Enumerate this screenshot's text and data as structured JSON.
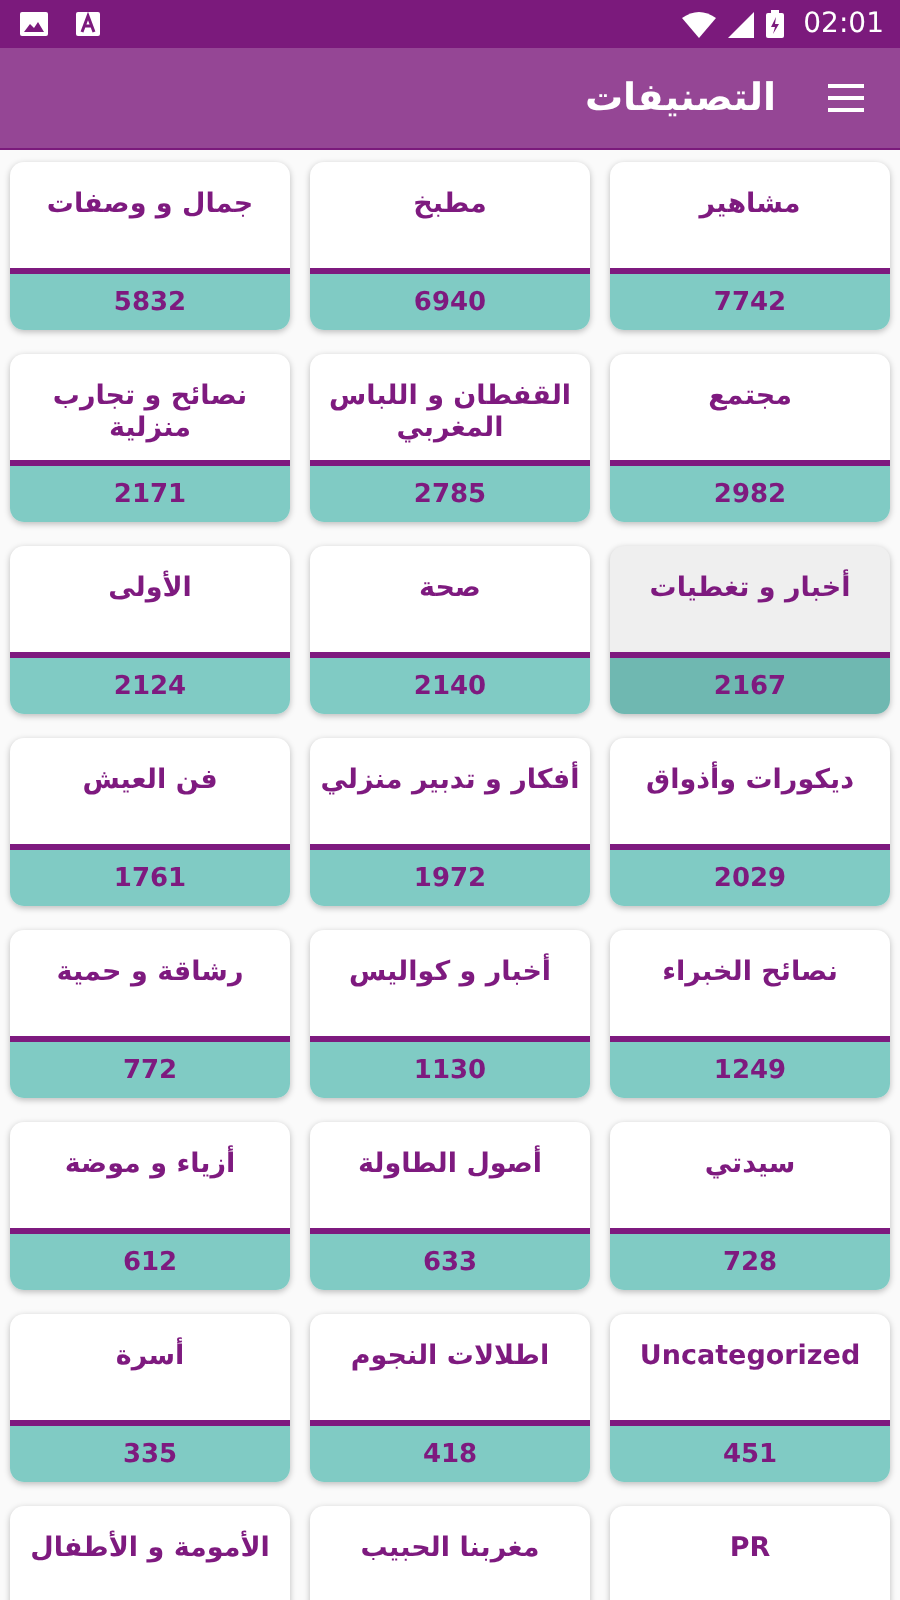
{
  "status_bar": {
    "time": "02:01"
  },
  "toolbar": {
    "title": "التصنيفات"
  },
  "categories": [
    {
      "name": "مشاهير",
      "count": "7742",
      "selected": false
    },
    {
      "name": "مطبخ",
      "count": "6940",
      "selected": false
    },
    {
      "name": "جمال و وصفات",
      "count": "5832",
      "selected": false
    },
    {
      "name": "مجتمع",
      "count": "2982",
      "selected": false
    },
    {
      "name": "القفطان و اللباس المغربي",
      "count": "2785",
      "selected": false
    },
    {
      "name": "نصائح و تجارب منزلية",
      "count": "2171",
      "selected": false
    },
    {
      "name": "أخبار و تغطيات",
      "count": "2167",
      "selected": true
    },
    {
      "name": "صحة",
      "count": "2140",
      "selected": false
    },
    {
      "name": "الأولى",
      "count": "2124",
      "selected": false
    },
    {
      "name": "ديكورات وأذواق",
      "count": "2029",
      "selected": false
    },
    {
      "name": "أفكار و تدبير منزلي",
      "count": "1972",
      "selected": false
    },
    {
      "name": "فن العيش",
      "count": "1761",
      "selected": false
    },
    {
      "name": "نصائح الخبراء",
      "count": "1249",
      "selected": false
    },
    {
      "name": "أخبار و كواليس",
      "count": "1130",
      "selected": false
    },
    {
      "name": "رشاقة و حمية",
      "count": "772",
      "selected": false
    },
    {
      "name": "سيدتي",
      "count": "728",
      "selected": false
    },
    {
      "name": "أصول الطاولة",
      "count": "633",
      "selected": false
    },
    {
      "name": "أزياء و موضة",
      "count": "612",
      "selected": false
    },
    {
      "name": "Uncategorized",
      "count": "451",
      "selected": false
    },
    {
      "name": "اطلالات النجوم",
      "count": "418",
      "selected": false
    },
    {
      "name": "أسرة",
      "count": "335",
      "selected": false
    },
    {
      "name": "PR",
      "selected": false
    },
    {
      "name": "مغربنا الحبيب",
      "selected": false
    },
    {
      "name": "الأمومة و الأطفال",
      "selected": false
    }
  ]
}
